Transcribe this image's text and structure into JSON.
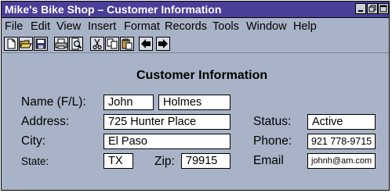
{
  "window": {
    "title": "Mike's Bike Shop – Customer Information"
  },
  "menu": [
    "File",
    "Edit",
    "View",
    "Insert",
    "Format",
    "Records",
    "Tools",
    "Window",
    "Help"
  ],
  "toolbar": {
    "icons": [
      "new-document-icon",
      "open-folder-icon",
      "save-disk-icon",
      "print-icon",
      "print-preview-icon",
      "cut-scissors-icon",
      "copy-icon",
      "paste-icon",
      "back-arrow-icon",
      "forward-arrow-icon"
    ]
  },
  "form": {
    "heading": "Customer Information",
    "name_label": "Name (F/L):",
    "first_name": "John",
    "last_name": "Holmes",
    "address_label": "Address:",
    "address": "725 Hunter Place",
    "city_label": "City:",
    "city": "El Paso",
    "state_label": "State:",
    "state": "TX",
    "zip_label": "Zip:",
    "zip": "79915",
    "status_label": "Status:",
    "status": "Active",
    "phone_label": "Phone:",
    "phone": "921 778-9715",
    "email_label": "Email",
    "email": "johnh@am.com"
  },
  "colors": {
    "titlebar": "#4a3f98",
    "background": "#a9b3c7"
  }
}
